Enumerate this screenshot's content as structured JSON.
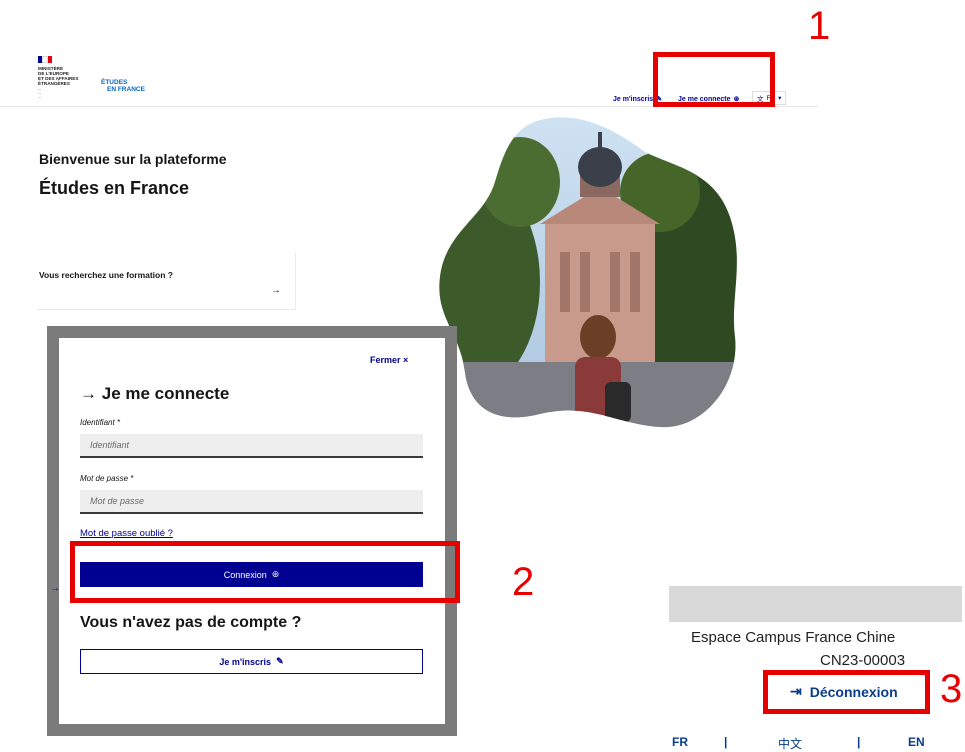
{
  "header": {
    "ministry_lines": [
      "MINISTÈRE",
      "DE L'EUROPE",
      "ET DES AFFAIRES",
      "ÉTRANGÈRES"
    ],
    "brand_line1": "ÉTUDES",
    "brand_line2": "EN FRANCE",
    "register_link": "Je m'inscris",
    "login_link": "Je me connecte",
    "lang_selector": "FR"
  },
  "hero": {
    "welcome": "Bienvenue sur la plateforme",
    "platform_name": "Études en France",
    "search_card_text": "Vous recherchez une formation ?",
    "search_card_arrow": "→"
  },
  "login_modal": {
    "close_label": "Fermer",
    "title": "Je me connecte",
    "identifier_label": "Identifiant *",
    "identifier_placeholder": "Identifiant",
    "password_label": "Mot de passe *",
    "password_placeholder": "Mot de passe",
    "forgot_password": "Mot de passe oublié ?",
    "connexion_button": "Connexion",
    "no_account_heading": "Vous n'avez pas de compte ?",
    "register_button": "Je m'inscris"
  },
  "campus_panel": {
    "name": "Espace Campus France Chine",
    "code": "CN23-00003",
    "logout": "Déconnexion",
    "languages": [
      "FR",
      "|",
      "中文",
      "|",
      "EN"
    ]
  },
  "annotations": {
    "step1": "1",
    "step2": "2",
    "step3": "3"
  },
  "colors": {
    "primary_blue": "#000091",
    "annotation_red": "#e60000",
    "link_blue": "#0a3c8c"
  }
}
